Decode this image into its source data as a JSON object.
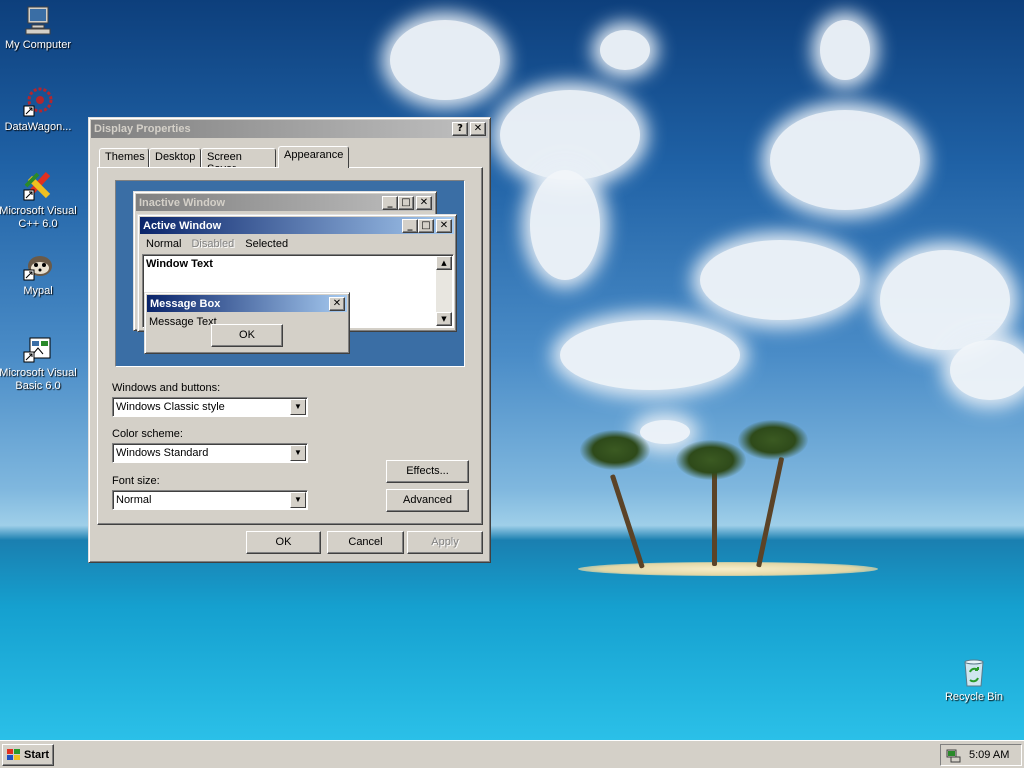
{
  "desktop": {
    "icons": [
      {
        "label": "My Computer",
        "icon": "computer-icon"
      },
      {
        "label": "DataWagon...",
        "icon": "datawagon-icon"
      },
      {
        "label": "Microsoft Visual C++ 6.0",
        "icon": "visual-cpp-icon"
      },
      {
        "label": "Mypal",
        "icon": "mypal-icon"
      },
      {
        "label": "Microsoft Visual Basic 6.0",
        "icon": "visual-basic-icon"
      },
      {
        "label": "Recycle Bin",
        "icon": "recycle-bin-icon"
      }
    ]
  },
  "dialog": {
    "title": "Display Properties",
    "help_glyph": "?",
    "close_glyph": "✕",
    "tabs": [
      {
        "label": "Themes"
      },
      {
        "label": "Desktop"
      },
      {
        "label": "Screen Saver"
      },
      {
        "label": "Appearance",
        "active": true
      }
    ],
    "preview": {
      "inactive_title": "Inactive Window",
      "active_title": "Active Window",
      "menu": [
        "Normal",
        "Disabled",
        "Selected"
      ],
      "window_text": "Window Text",
      "message_box_title": "Message Box",
      "message_text": "Message Text",
      "ok_label": "OK",
      "min_glyph": "_",
      "max_glyph": "□",
      "close_glyph": "✕",
      "scroll_up_glyph": "▲",
      "scroll_down_glyph": "▼"
    },
    "windows_buttons": {
      "label": "Windows and buttons:",
      "value": "Windows Classic style"
    },
    "color_scheme": {
      "label": "Color scheme:",
      "value": "Windows Standard"
    },
    "font_size": {
      "label": "Font size:",
      "value": "Normal"
    },
    "dropdown_glyph": "▼",
    "effects_label": "Effects...",
    "advanced_label": "Advanced",
    "ok_label": "OK",
    "cancel_label": "Cancel",
    "apply_label": "Apply"
  },
  "taskbar": {
    "start_label": "Start",
    "clock": "5:09 AM"
  },
  "colors": {
    "active_title_start": "#0a246a",
    "active_title_end": "#a6caf0",
    "inactive_title_start": "#808080",
    "preview_desktop": "#3a6ea5",
    "dialog_face": "#d4d0c8"
  }
}
